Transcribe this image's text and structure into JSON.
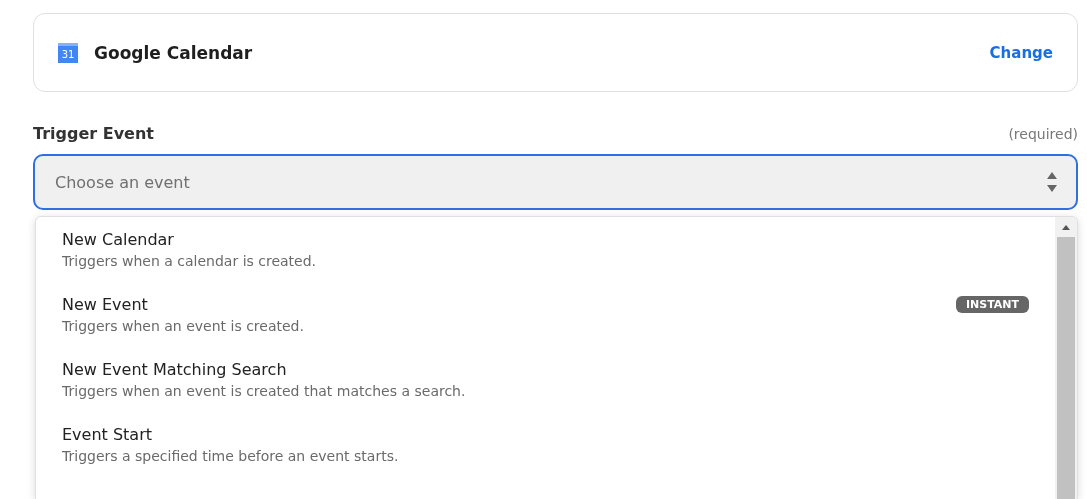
{
  "app_card": {
    "name": "Google Calendar",
    "icon_text": "31",
    "action": "Change"
  },
  "trigger_event": {
    "label": "Trigger Event",
    "hint": "(required)",
    "placeholder": "Choose an event",
    "expanded": true
  },
  "options": [
    {
      "title": "New Calendar",
      "description": "Triggers when a calendar is created."
    },
    {
      "title": "New Event",
      "description": "Triggers when an event is created.",
      "badge": "INSTANT"
    },
    {
      "title": "New Event Matching Search",
      "description": "Triggers when an event is created that matches a search."
    },
    {
      "title": "Event Start",
      "description": "Triggers a specified time before an event starts."
    }
  ]
}
